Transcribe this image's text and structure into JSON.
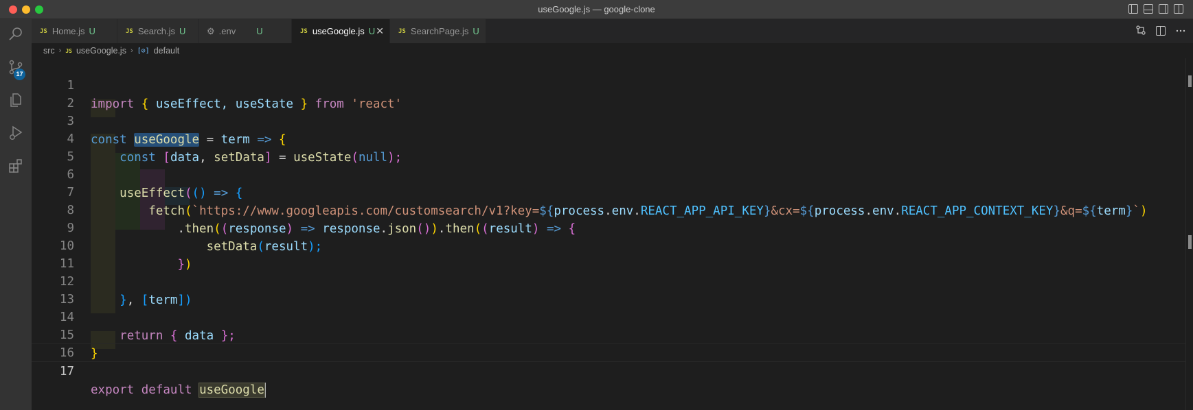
{
  "window": {
    "title": "useGoogle.js — google-clone"
  },
  "activity_bar": {
    "items": [
      "search-icon",
      "source-control-icon",
      "explorer-icon",
      "run-debug-icon",
      "extensions-icon"
    ],
    "scm_badge": "17"
  },
  "tabs": [
    {
      "label": "Home.js",
      "status": "U",
      "icon": "JS"
    },
    {
      "label": "Search.js",
      "status": "U",
      "icon": "JS"
    },
    {
      "label": ".env",
      "status": "U",
      "icon": "⚙"
    },
    {
      "label": "useGoogle.js",
      "status": "U",
      "icon": "JS",
      "active": true,
      "close": "✕"
    },
    {
      "label": "SearchPage.js",
      "status": "U",
      "icon": "JS"
    }
  ],
  "breadcrumb": {
    "folder": "src",
    "file_icon": "JS",
    "file": "useGoogle.js",
    "symbol_icon": "[⊘]",
    "symbol": "default"
  },
  "editor": {
    "line_numbers": [
      "1",
      "2",
      "3",
      "4",
      "5",
      "6",
      "7",
      "8",
      "9",
      "10",
      "11",
      "12",
      "13",
      "14",
      "15",
      "16",
      "17"
    ],
    "current_line": "17",
    "tokens": {
      "l1": [
        "import",
        " ",
        "{",
        " useEffect, useState ",
        "}",
        " from ",
        "'react'"
      ],
      "l3": [
        "const",
        " ",
        "useGoogle",
        " = ",
        "term",
        " ",
        "=>",
        " ",
        "{"
      ],
      "l4": [
        "const",
        " ",
        "[",
        "data",
        ", ",
        "setData",
        "]",
        " = ",
        "useState",
        "(",
        "null",
        ");"
      ],
      "l6": [
        "useEffect",
        "(",
        "()",
        " ",
        "=>",
        " ",
        "{"
      ],
      "l7": [
        "fetch",
        "(",
        "`https://www.googleapis.com/customsearch/v1?key=",
        "${",
        "process",
        ".",
        "env",
        ".",
        "REACT_APP_API_KEY",
        "}",
        "&cx=",
        "${",
        "process",
        ".",
        "env",
        ".",
        "REACT_APP_CONTEXT_KEY",
        "}",
        "&q=",
        "${",
        "term",
        "}",
        "`",
        ")"
      ],
      "l8": [
        ".",
        "then",
        "(",
        "(",
        "response",
        ")",
        " => ",
        "response",
        ".",
        "json",
        "()",
        ")",
        ".",
        "then",
        "(",
        "(",
        "result",
        ")",
        " => ",
        "{"
      ],
      "l9": [
        "setData",
        "(",
        "result",
        ");"
      ],
      "l10": [
        "}",
        ")"
      ],
      "l12": [
        "}",
        ", ",
        "[",
        "term",
        "])"
      ],
      "l14": [
        "return",
        " ",
        "{",
        " ",
        "data",
        " ",
        "};"
      ],
      "l15": [
        "}"
      ],
      "l17": [
        "export",
        " ",
        "default",
        " ",
        "useGoogle"
      ]
    }
  },
  "colors": {
    "editor_bg": "#1e1e1e",
    "keyword": "#c586c0",
    "storage": "#569cd6",
    "function": "#dcdcaa",
    "variable": "#9cdcfe",
    "constant": "#4fc1ff",
    "string": "#ce9178",
    "untracked": "#73c991",
    "badge": "#0e639c"
  }
}
